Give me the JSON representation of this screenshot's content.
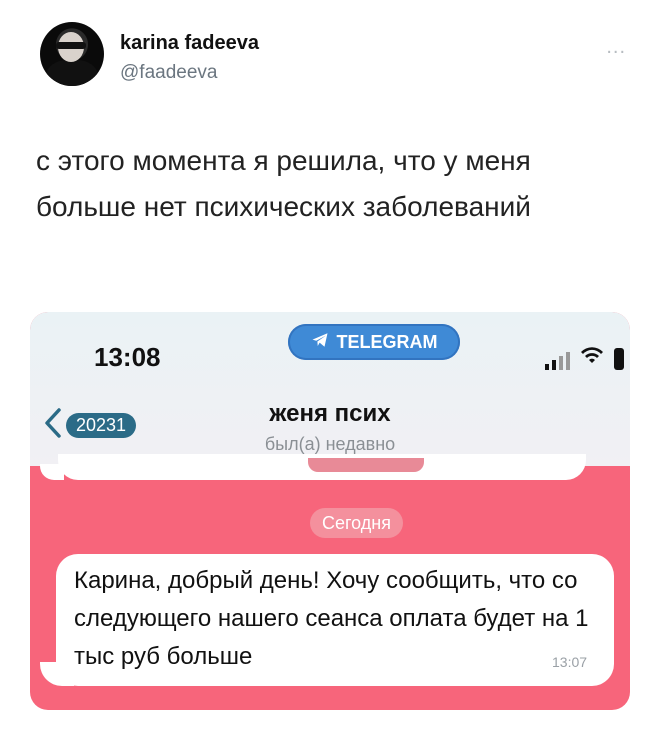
{
  "tweet": {
    "author_name": "karina fadeeva",
    "author_handle": "@faadeeva",
    "more_label": "...",
    "text": "с этого момента я решила, что у меня больше нет психических заболеваний"
  },
  "screenshot": {
    "status_bar": {
      "time": "13:08",
      "app_pill": "TELEGRAM",
      "icons": [
        "signal-icon",
        "wifi-icon",
        "battery-icon"
      ]
    },
    "chat_header": {
      "back_badge": "20231",
      "title": "женя псих",
      "subtitle": "был(а) недавно"
    },
    "date_separator": "Сегодня",
    "message": {
      "text": "Карина, добрый день! Хочу сообщить, что со следующего нашего сеанса оплата будет на 1 тыс руб больше",
      "time": "13:07"
    },
    "colors": {
      "chat_background": "#f7657b",
      "telegram_pill": "#3f8ad6",
      "badge": "#2b6b87",
      "bubble": "#ffffff"
    }
  }
}
